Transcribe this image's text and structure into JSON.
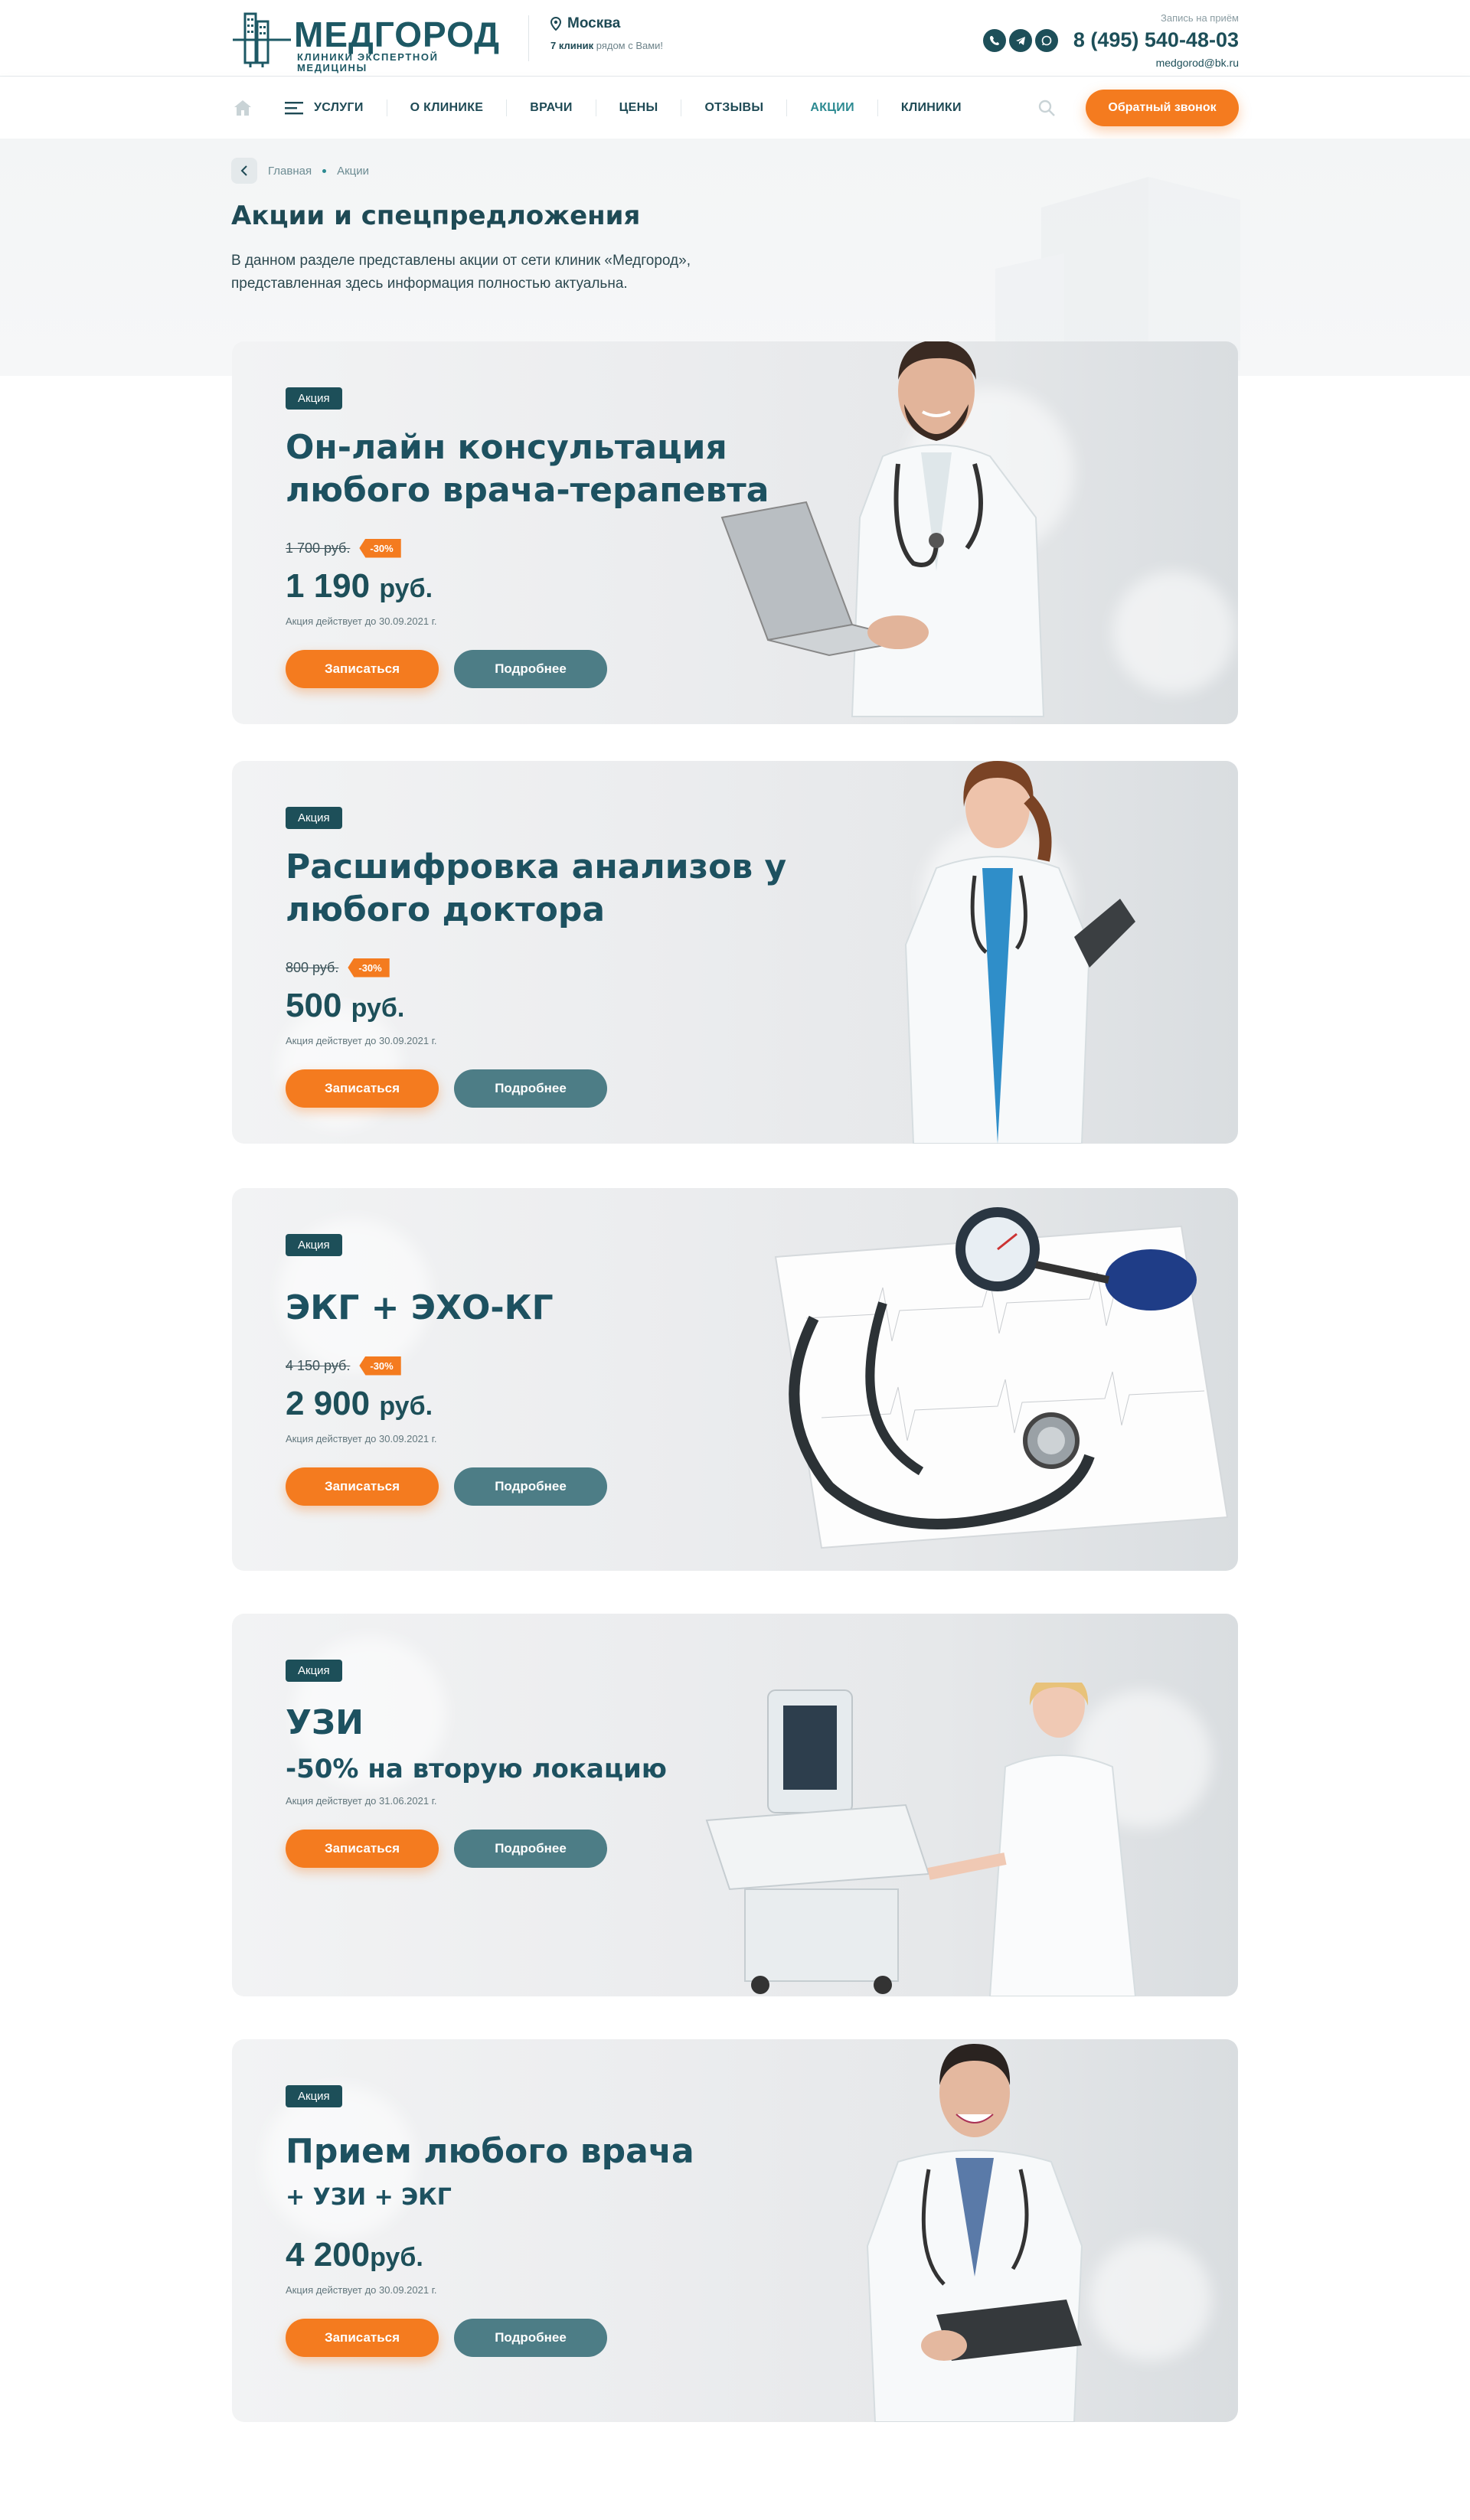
{
  "header": {
    "logo_name": "МЕДГОРОД",
    "logo_subtitle": "КЛИНИКИ ЭКСПЕРТНОЙ МЕДИЦИНЫ",
    "city": "Москва",
    "clinics_count": "7 клиник",
    "clinics_suffix": "рядом с Вами!",
    "appointment_hint": "Запись на приём",
    "phone": "8 (495) 540-48-03",
    "email": "medgorod@bk.ru"
  },
  "nav": {
    "items": [
      {
        "label": "УСЛУГИ"
      },
      {
        "label": "О КЛИНИКЕ"
      },
      {
        "label": "ВРАЧИ"
      },
      {
        "label": "ЦЕНЫ"
      },
      {
        "label": "ОТЗЫВЫ"
      },
      {
        "label": "АКЦИИ"
      },
      {
        "label": "КЛИНИКИ"
      }
    ],
    "active": "АКЦИИ",
    "callback_label": "Обратный звонок"
  },
  "breadcrumb": {
    "home": "Главная",
    "current": "Акции"
  },
  "page": {
    "title": "Акции и спецпредложения",
    "description": "В данном разделе представлены акции от сети клиник «Медгород», представленная здесь информация полностью актуальна."
  },
  "promos": [
    {
      "badge": "Акция",
      "title_line1": "Он-лайн консультация",
      "title_line2": "любого врача-терапевта",
      "old_price": "1 700 руб.",
      "discount": "-30%",
      "new_price": "1 190",
      "currency": "руб.",
      "valid": "Акция действует до 30.09.2021 г.",
      "primary_label": "Записаться",
      "secondary_label": "Подробнее"
    },
    {
      "badge": "Акция",
      "title_line1": "Расшифровка анализов у",
      "title_line2": "любого доктора",
      "old_price": "800 руб.",
      "discount": "-30%",
      "new_price": "500",
      "currency": "руб.",
      "valid": "Акция действует до 30.09.2021 г.",
      "primary_label": "Записаться",
      "secondary_label": "Подробнее"
    },
    {
      "badge": "Акция",
      "title_line1": "ЭКГ + ЭХО-КГ",
      "old_price": "4 150 руб.",
      "discount": "-30%",
      "new_price": "2 900",
      "currency": "руб.",
      "valid": "Акция действует до 30.09.2021 г.",
      "primary_label": "Записаться",
      "secondary_label": "Подробнее"
    },
    {
      "badge": "Акция",
      "title_line1": "УЗИ",
      "subtitle": "-50% на вторую локацию",
      "valid": "Акция действует до 31.06.2021 г.",
      "primary_label": "Записаться",
      "secondary_label": "Подробнее"
    },
    {
      "badge": "Акция",
      "title_line1": "Прием любого врача",
      "subtitle": "+ УЗИ + ЭКГ",
      "new_price": "4 200",
      "currency": "руб.",
      "valid": "Акция действует до 30.09.2021 г.",
      "primary_label": "Записаться",
      "secondary_label": "Подробнее"
    }
  ],
  "icons": {
    "logo": "building-logo-icon",
    "location": "map-pin-icon",
    "messengers": [
      "viber-icon",
      "telegram-icon",
      "whatsapp-icon"
    ],
    "home": "home-icon",
    "menu": "hamburger-icon",
    "search": "search-icon",
    "back": "chevron-left-icon"
  },
  "colors": {
    "brand": "#1d4f59",
    "accent": "#f47b1f",
    "secondary_button": "#4d7d86",
    "active_nav": "#2c8a91"
  }
}
